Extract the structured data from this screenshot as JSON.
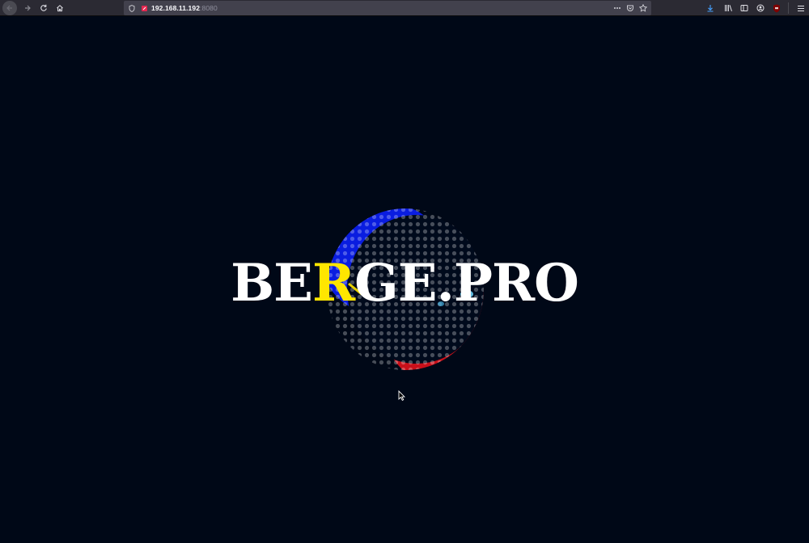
{
  "browser": {
    "url_host": "192.168.11.192",
    "url_port": ":8080",
    "icons": {
      "back": "back-arrow-icon",
      "forward": "forward-arrow-icon",
      "reload": "reload-icon",
      "home": "home-icon",
      "shield": "tracking-shield-icon",
      "site": "site-warning-icon",
      "more": "more-actions-icon",
      "pocket": "pocket-icon",
      "bookmark": "bookmark-star-icon",
      "download": "download-icon",
      "library": "library-icon",
      "sidebar": "sidebar-icon",
      "account": "account-icon",
      "extension": "ublock-extension-icon",
      "menu": "hamburger-menu-icon"
    }
  },
  "page": {
    "brand_prefix": "BE",
    "brand_highlight": "R",
    "brand_suffix": "GE.PRO",
    "background_color": "#000817",
    "highlight_color": "#ffe600"
  }
}
